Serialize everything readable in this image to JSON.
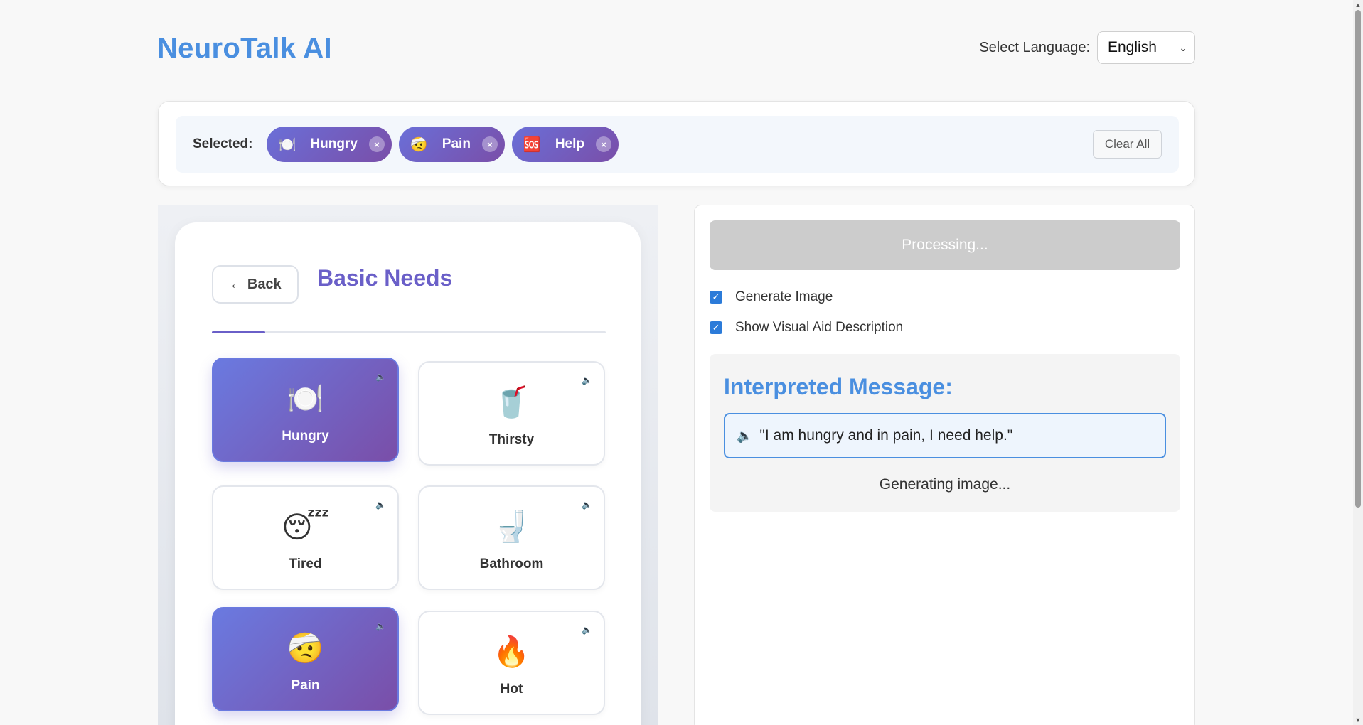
{
  "app": {
    "title": "NeuroTalk AI"
  },
  "language": {
    "label": "Select Language:",
    "selected": "English"
  },
  "selection": {
    "label": "Selected:",
    "chips": [
      {
        "emoji": "🍽️",
        "label": "Hungry",
        "remove": "×"
      },
      {
        "emoji": "🤕",
        "label": "Pain",
        "remove": "×"
      },
      {
        "emoji": "🆘",
        "label": "Help",
        "remove": "×"
      }
    ],
    "clear_label": "Clear All"
  },
  "category": {
    "back_label": "← Back",
    "title": "Basic Needs",
    "progress_fraction": 0.135,
    "tiles": [
      {
        "emoji": "🍽️",
        "label": "Hungry",
        "selected": true
      },
      {
        "emoji": "🥤",
        "label": "Thirsty",
        "selected": false
      },
      {
        "emoji": "😴",
        "label": "Tired",
        "selected": false
      },
      {
        "emoji": "🚽",
        "label": "Bathroom",
        "selected": false
      },
      {
        "emoji": "🤕",
        "label": "Pain",
        "selected": true
      },
      {
        "emoji": "🔥",
        "label": "Hot",
        "selected": false
      }
    ],
    "speaker_glyph": "🔈"
  },
  "output": {
    "process_label": "Processing...",
    "options": [
      {
        "label": "Generate Image",
        "checked": true
      },
      {
        "label": "Show Visual Aid Description",
        "checked": true
      }
    ],
    "interpreted_title": "Interpreted Message:",
    "message": "\"I am hungry and in pain, I need help.\"",
    "speaker_glyph": "🔈",
    "status": "Generating image..."
  },
  "colors": {
    "brand_blue": "#4a8fe0",
    "accent_purple": "#6a5fc8",
    "chip_gradient_start": "#6a6fd8",
    "chip_gradient_end": "#7a4ea8",
    "disabled_gray": "#cccccc"
  }
}
